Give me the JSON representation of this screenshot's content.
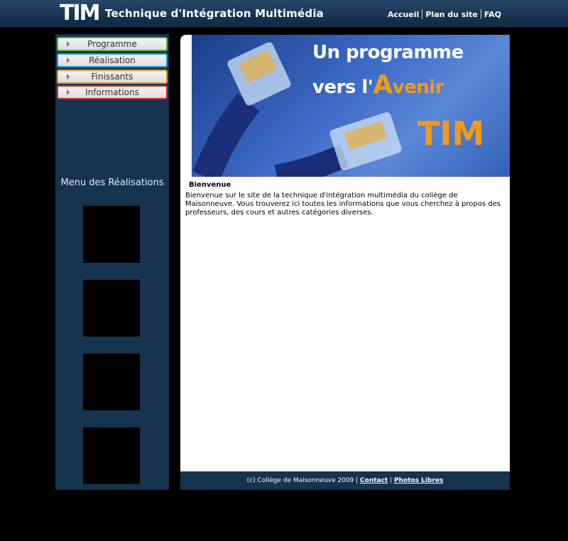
{
  "header": {
    "logo": "TIM",
    "title": "Technique d'Intégration Multimédia",
    "nav": [
      "Accueil",
      "Plan du site",
      "FAQ"
    ]
  },
  "sidebar": {
    "menu": [
      {
        "label": "Programme",
        "color": "#5cb83a"
      },
      {
        "label": "Réalisation",
        "color": "#2a9ad8"
      },
      {
        "label": "Finissants",
        "color": "#e59a1a"
      },
      {
        "label": "Informations",
        "color": "#d42a2a"
      }
    ],
    "menu_title": "Menu des Réalisations"
  },
  "banner": {
    "line1": "Un programme",
    "line2_pre": "vers l'",
    "line2_big": "A",
    "line2_post": "venir",
    "line3": "TIM"
  },
  "main": {
    "section_title": "Bienvenue",
    "intro": "Bienvenue sur le site de la technique d'intégration multimédia du collège de Maisonneuve. Vous trouverez ici toutes les informations que vous cherchez à propos des professeurs, des cours et autres catégories diverses."
  },
  "footer": {
    "copyright": "(c) Collège de Maisonneuve 2009 | ",
    "contact": "Contact",
    "sep": " | ",
    "photos": "Photos Libres"
  }
}
